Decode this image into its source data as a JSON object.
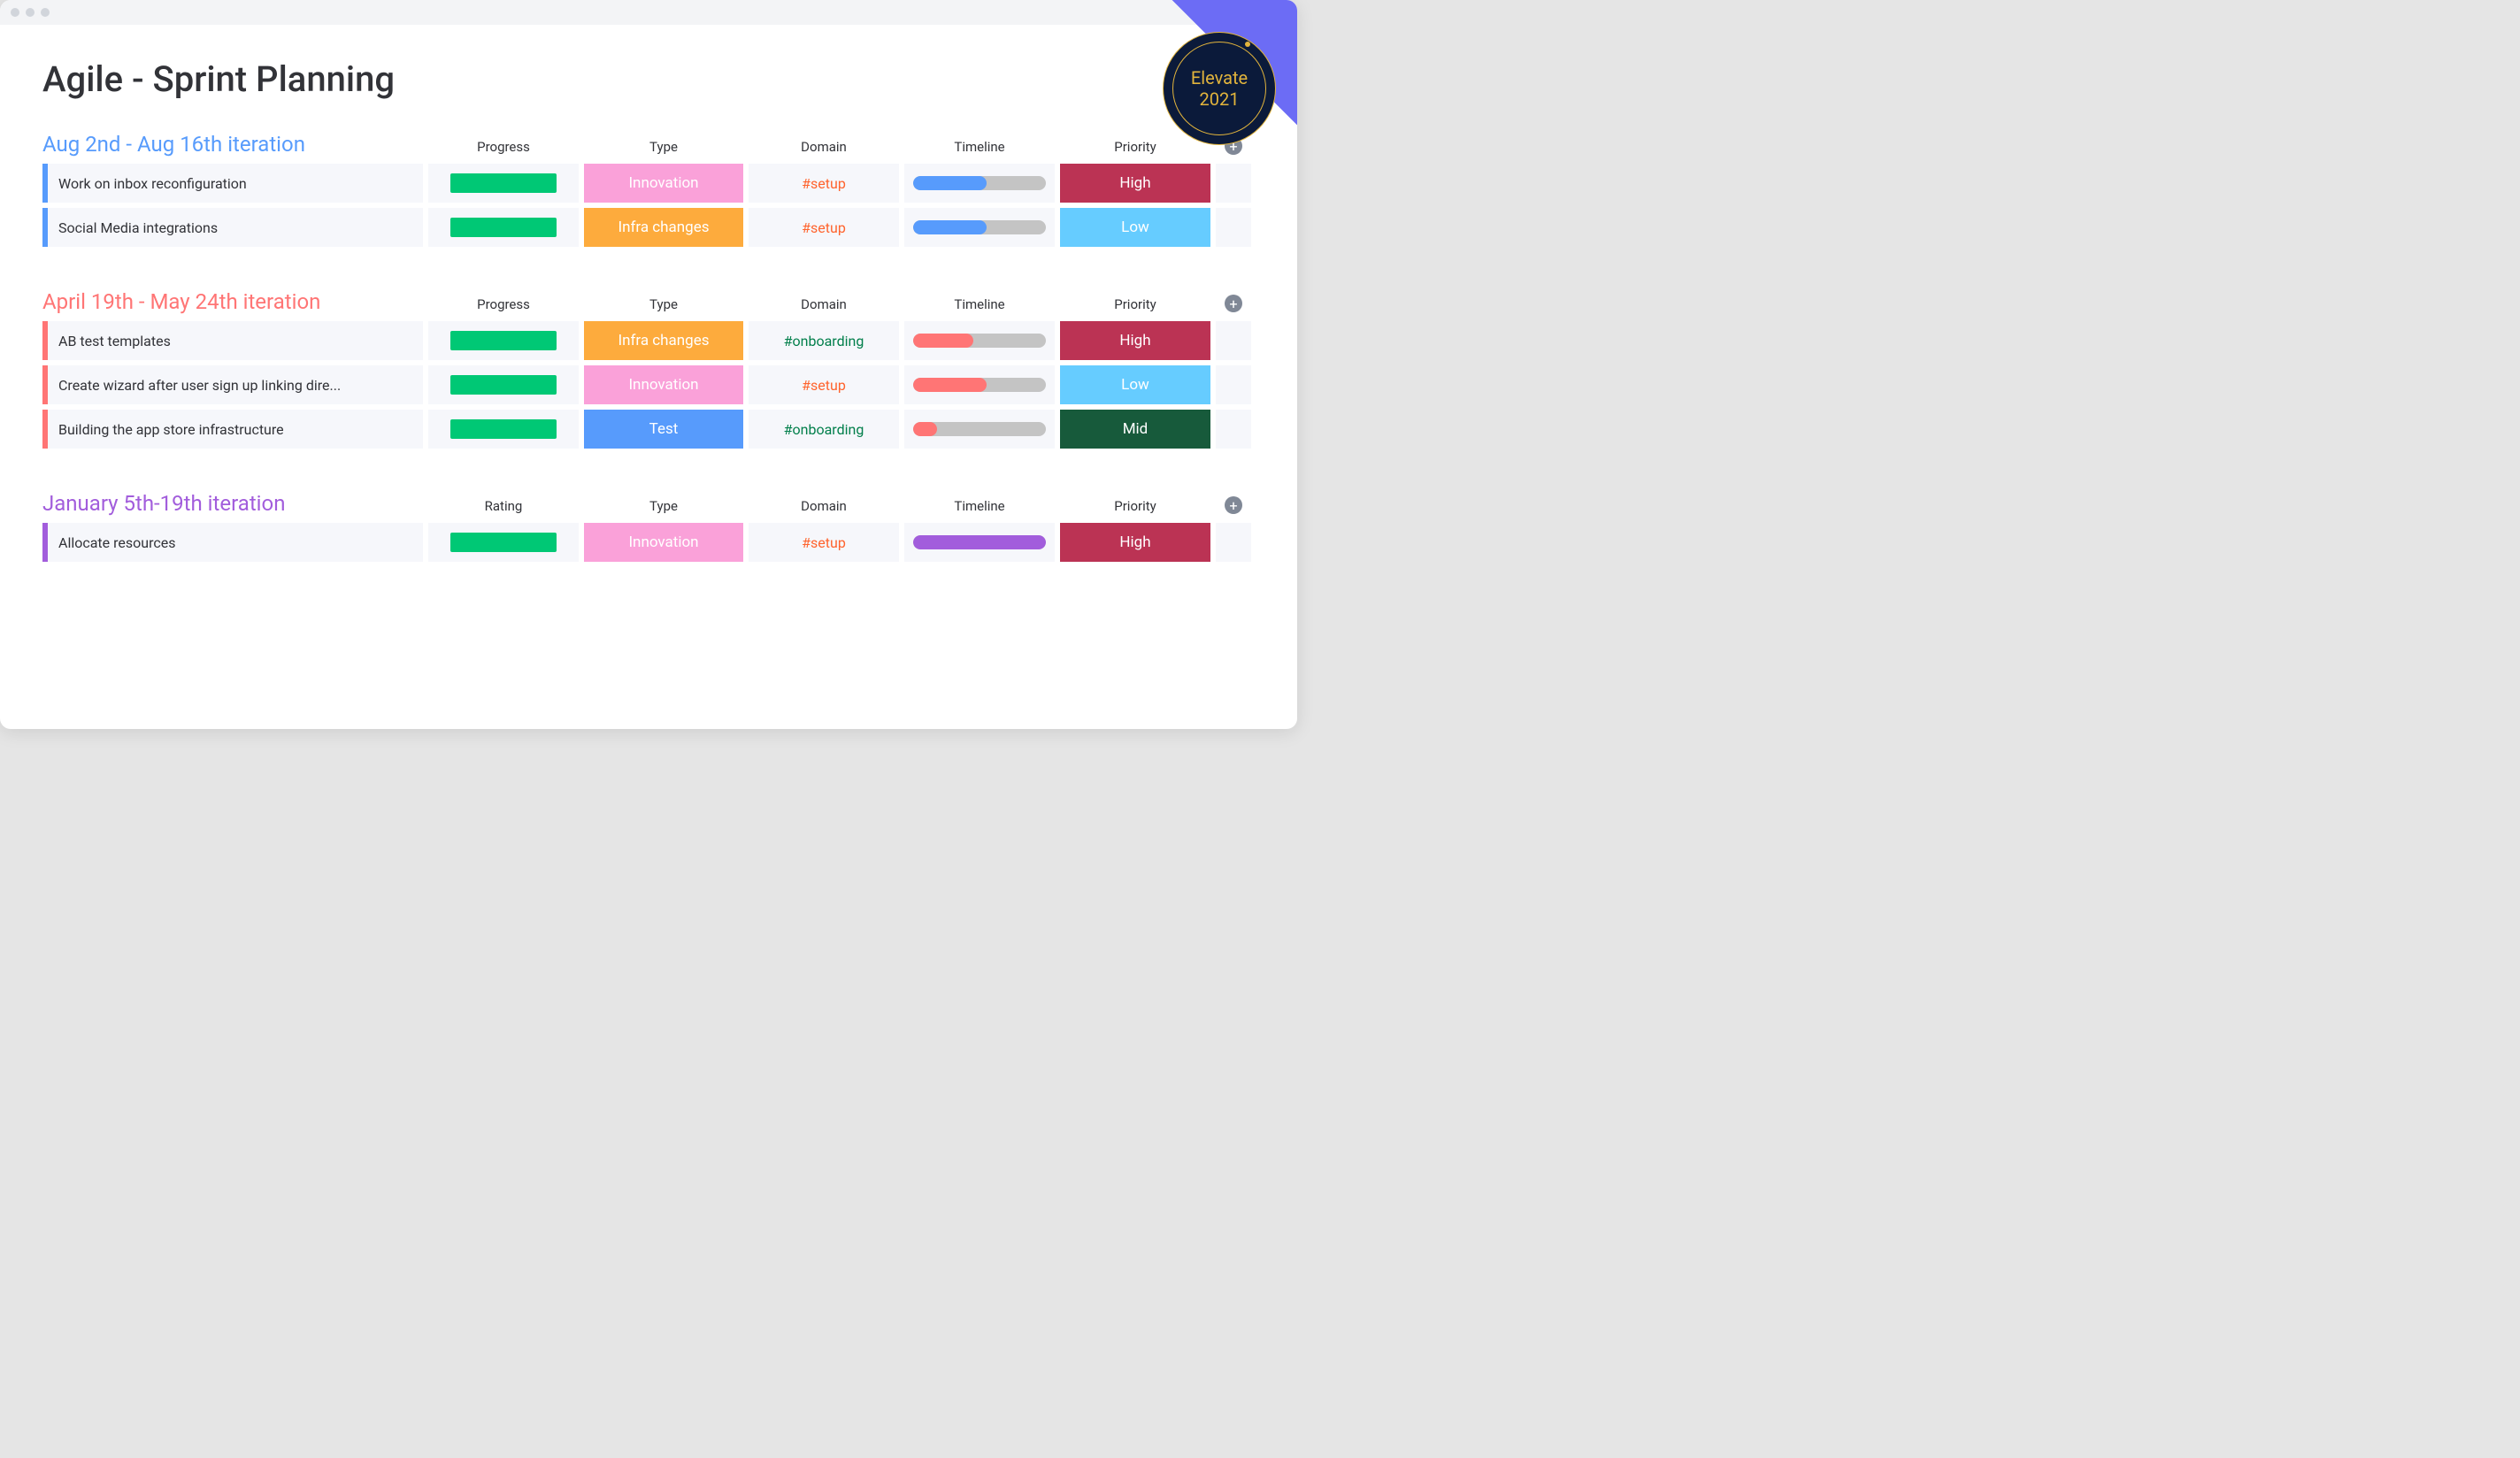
{
  "page_title": "Agile - Sprint Planning",
  "badge": {
    "line1": "Elevate",
    "line2": "2021"
  },
  "colors": {
    "green": "#00c875",
    "pink": "#faa1d9",
    "orange": "#fdab3d",
    "blue": "#579bfc",
    "darkgreen": "#175a3b",
    "crimson": "#bb3354",
    "skyblue": "#66ccff",
    "purple": "#a25ddc",
    "salmon": "#ff7575",
    "track": "#c4c4c4"
  },
  "groups": [
    {
      "title": "Aug 2nd - Aug 16th iteration",
      "title_color": "#579bfc",
      "border_color": "#579bfc",
      "columns": [
        "Progress",
        "Type",
        "Domain",
        "Timeline",
        "Priority"
      ],
      "rows": [
        {
          "task": "Work on inbox reconfiguration",
          "progress_color": "#00c875",
          "type": {
            "label": "Innovation",
            "bg": "#faa1d9"
          },
          "domain": {
            "label": "#setup",
            "color": "#ff642e"
          },
          "timeline": {
            "fill": 55,
            "color": "#579bfc"
          },
          "priority": {
            "label": "High",
            "bg": "#bb3354"
          }
        },
        {
          "task": "Social Media integrations",
          "progress_color": "#00c875",
          "type": {
            "label": "Infra changes",
            "bg": "#fdab3d"
          },
          "domain": {
            "label": "#setup",
            "color": "#ff642e"
          },
          "timeline": {
            "fill": 55,
            "color": "#579bfc"
          },
          "priority": {
            "label": "Low",
            "bg": "#66ccff"
          }
        }
      ]
    },
    {
      "title": "April 19th - May 24th iteration",
      "title_color": "#ff7575",
      "border_color": "#ff7575",
      "columns": [
        "Progress",
        "Type",
        "Domain",
        "Timeline",
        "Priority"
      ],
      "rows": [
        {
          "task": "AB test templates",
          "progress_color": "#00c875",
          "type": {
            "label": "Infra changes",
            "bg": "#fdab3d"
          },
          "domain": {
            "label": "#onboarding",
            "color": "#027f4b"
          },
          "timeline": {
            "fill": 45,
            "color": "#ff7575"
          },
          "priority": {
            "label": "High",
            "bg": "#bb3354"
          }
        },
        {
          "task": "Create wizard after user sign up linking dire...",
          "progress_color": "#00c875",
          "type": {
            "label": "Innovation",
            "bg": "#faa1d9"
          },
          "domain": {
            "label": "#setup",
            "color": "#ff642e"
          },
          "timeline": {
            "fill": 55,
            "color": "#ff7575"
          },
          "priority": {
            "label": "Low",
            "bg": "#66ccff"
          }
        },
        {
          "task": "Building the app store infrastructure",
          "progress_color": "#00c875",
          "type": {
            "label": "Test",
            "bg": "#579bfc"
          },
          "domain": {
            "label": "#onboarding",
            "color": "#027f4b"
          },
          "timeline": {
            "fill": 18,
            "color": "#ff7575"
          },
          "priority": {
            "label": "Mid",
            "bg": "#175a3b"
          }
        }
      ]
    },
    {
      "title": "January 5th-19th iteration",
      "title_color": "#a25ddc",
      "border_color": "#a25ddc",
      "columns": [
        "Rating",
        "Type",
        "Domain",
        "Timeline",
        "Priority"
      ],
      "rows": [
        {
          "task": "Allocate resources",
          "progress_color": "#00c875",
          "type": {
            "label": "Innovation",
            "bg": "#faa1d9"
          },
          "domain": {
            "label": "#setup",
            "color": "#ff642e"
          },
          "timeline": {
            "fill": 100,
            "color": "#a25ddc"
          },
          "priority": {
            "label": "High",
            "bg": "#bb3354"
          }
        }
      ]
    }
  ]
}
